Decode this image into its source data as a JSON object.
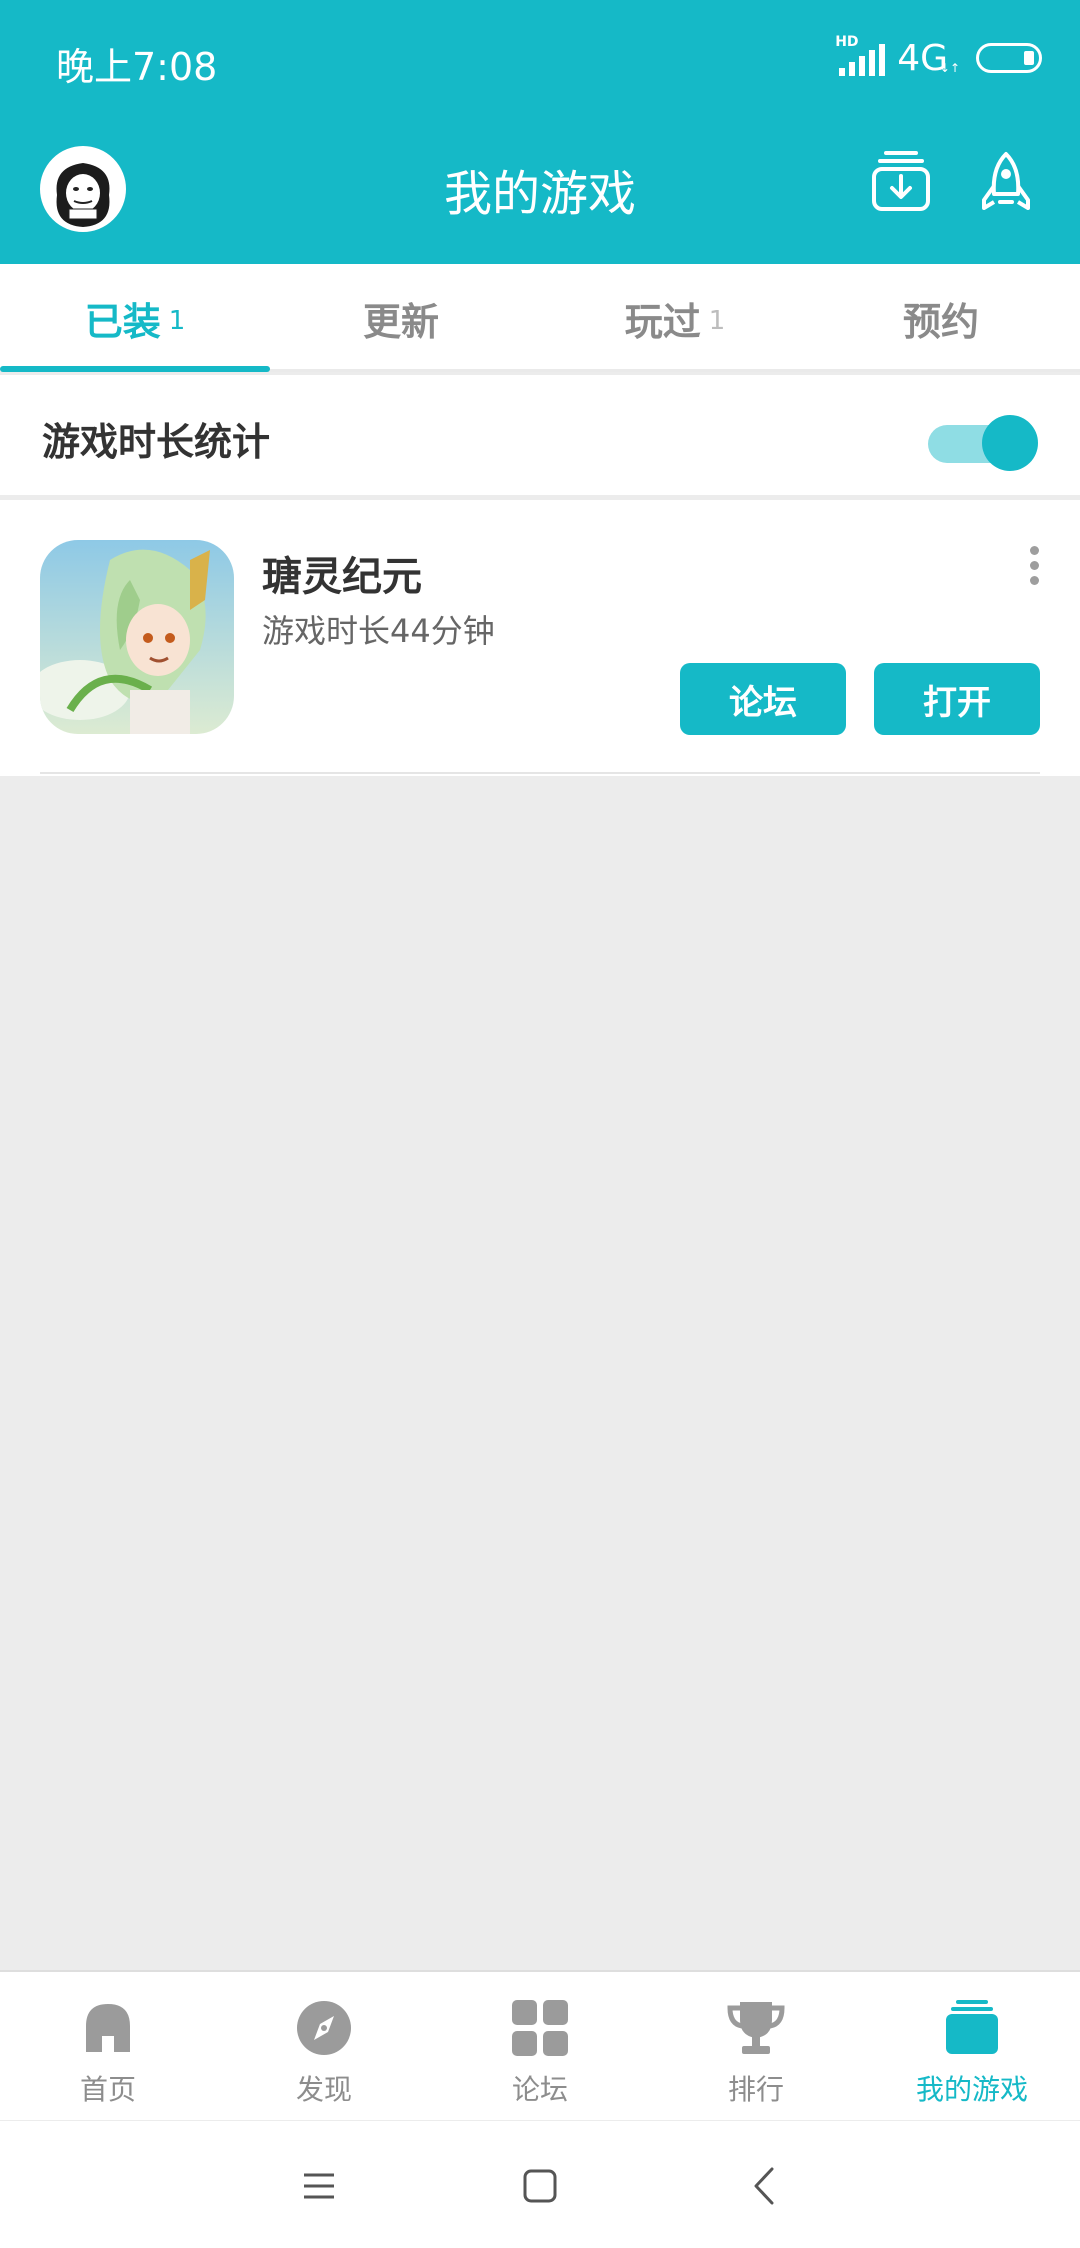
{
  "status_bar": {
    "time": "晚上7:08",
    "signal_badge": "HD",
    "network": "4G",
    "network_sub": "↓↑"
  },
  "header": {
    "title": "我的游戏",
    "avatar_icon": "avatar-meme-icon",
    "download_icon": "download-manager-icon",
    "rocket_icon": "rocket-boost-icon"
  },
  "tabs": [
    {
      "label": "已装",
      "count": "1",
      "active": true
    },
    {
      "label": "更新",
      "count": "",
      "active": false
    },
    {
      "label": "玩过",
      "count": "1",
      "active": false
    },
    {
      "label": "预约",
      "count": "",
      "active": false
    }
  ],
  "stats": {
    "label": "游戏时长统计",
    "toggle_on": true
  },
  "game": {
    "name": "瑭灵纪元",
    "playtime": "游戏时长44分钟",
    "forum_label": "论坛",
    "open_label": "打开"
  },
  "bottom_nav": [
    {
      "label": "首页",
      "icon": "home-icon",
      "active": false
    },
    {
      "label": "发现",
      "icon": "compass-icon",
      "active": false
    },
    {
      "label": "论坛",
      "icon": "grid-icon",
      "active": false
    },
    {
      "label": "排行",
      "icon": "trophy-icon",
      "active": false
    },
    {
      "label": "我的游戏",
      "icon": "games-stack-icon",
      "active": true
    }
  ],
  "colors": {
    "accent": "#15b9c7",
    "background": "#ececec",
    "inactive": "#8d8d8d"
  }
}
